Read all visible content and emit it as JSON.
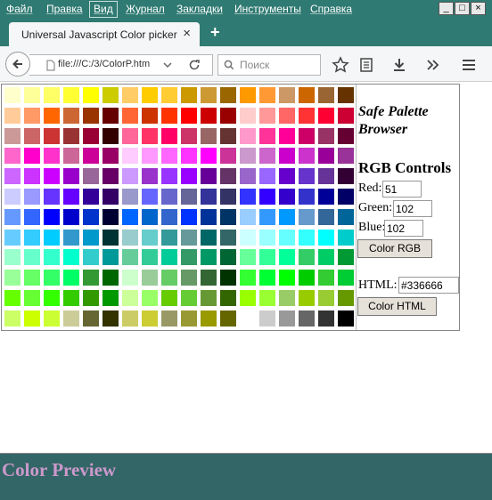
{
  "menu": {
    "items": [
      "Файл",
      "Правка",
      "Вид",
      "Журнал",
      "Закладки",
      "Инструменты",
      "Справка"
    ],
    "active_index": 2
  },
  "window_controls": [
    "_",
    "□",
    "×"
  ],
  "tab": {
    "title": "Universal Javascript Color picker",
    "close": "×",
    "new_tab": "+"
  },
  "navbar": {
    "url": "file:///C:/3/ColorP.htm",
    "search_placeholder": "Поиск",
    "icons": [
      "back-icon",
      "page-icon",
      "dropdown-icon",
      "reload-icon",
      "search-icon",
      "bookmark-star-icon",
      "reading-list-icon",
      "download-icon",
      "overflow-icon",
      "hamburger-menu-icon"
    ]
  },
  "palette": {
    "rows": [
      [
        "#ffffcc",
        "#ffff99",
        "#ffff66",
        "#ffff33",
        "#ffff00",
        "#cccc00",
        "#ffcc66",
        "#ffcc00",
        "#ffcc33",
        "#cc9900",
        "#cc9933",
        "#996600",
        "#ff9900",
        "#ff9933",
        "#cc9966",
        "#cc6600",
        "#996633",
        "#663300"
      ],
      [
        "#ffcc99",
        "#ff9966",
        "#ff6600",
        "#cc6633",
        "#993300",
        "#660000",
        "#ff6633",
        "#cc3300",
        "#ff3300",
        "#ff0000",
        "#cc0000",
        "#990000",
        "#ffcccc",
        "#ff9999",
        "#ff6666",
        "#ff3333",
        "#ff0033",
        "#cc0033"
      ],
      [
        "#cc9999",
        "#cc6666",
        "#cc3333",
        "#993333",
        "#990033",
        "#330000",
        "#ff6699",
        "#ff3366",
        "#ff0066",
        "#cc3366",
        "#996666",
        "#663333",
        "#ff99cc",
        "#ff3399",
        "#ff0099",
        "#cc0066",
        "#993366",
        "#660033"
      ],
      [
        "#ff66cc",
        "#ff00cc",
        "#ff33cc",
        "#cc6699",
        "#cc0099",
        "#990066",
        "#ffccff",
        "#ff99ff",
        "#ff66ff",
        "#ff33ff",
        "#ff00ff",
        "#cc3399",
        "#cc99cc",
        "#cc66cc",
        "#cc00cc",
        "#cc33cc",
        "#990099",
        "#993399"
      ],
      [
        "#cc66ff",
        "#cc33ff",
        "#cc00ff",
        "#9900cc",
        "#996699",
        "#660066",
        "#cc99ff",
        "#9933cc",
        "#9933ff",
        "#9900ff",
        "#660099",
        "#663366",
        "#9966cc",
        "#9966ff",
        "#6600cc",
        "#6633cc",
        "#663399",
        "#330033"
      ],
      [
        "#ccccff",
        "#9999ff",
        "#6633ff",
        "#6600ff",
        "#330099",
        "#330066",
        "#9999cc",
        "#6666ff",
        "#6666cc",
        "#666699",
        "#333399",
        "#333366",
        "#3333ff",
        "#3300ff",
        "#3300cc",
        "#3333cc",
        "#000099",
        "#000066"
      ],
      [
        "#6699ff",
        "#3366ff",
        "#0000ff",
        "#0000cc",
        "#0033cc",
        "#000033",
        "#0066ff",
        "#0066cc",
        "#3366cc",
        "#0033ff",
        "#003399",
        "#003366",
        "#99ccff",
        "#3399ff",
        "#0099ff",
        "#6699cc",
        "#336699",
        "#006699"
      ],
      [
        "#66ccff",
        "#33ccff",
        "#00ccff",
        "#3399cc",
        "#0099cc",
        "#003333",
        "#99cccc",
        "#66cccc",
        "#339999",
        "#669999",
        "#006666",
        "#336666",
        "#ccffff",
        "#99ffff",
        "#66ffff",
        "#33ffff",
        "#00ffff",
        "#00cccc"
      ],
      [
        "#99ffcc",
        "#66ffcc",
        "#33ffcc",
        "#00ffcc",
        "#33cccc",
        "#009999",
        "#66cc99",
        "#33cc99",
        "#00cc99",
        "#339966",
        "#009966",
        "#006633",
        "#66ff99",
        "#33ff99",
        "#00ff99",
        "#33cc66",
        "#00cc66",
        "#009933"
      ],
      [
        "#99ff99",
        "#66ff66",
        "#33ff66",
        "#00ff66",
        "#339933",
        "#006600",
        "#ccffcc",
        "#99cc99",
        "#66cc66",
        "#669966",
        "#336633",
        "#003300",
        "#33ff33",
        "#00ff33",
        "#00ff00",
        "#00cc00",
        "#33cc33",
        "#00cc33"
      ],
      [
        "#66ff00",
        "#66ff33",
        "#33ff00",
        "#33cc00",
        "#339900",
        "#009900",
        "#ccff99",
        "#99ff66",
        "#66cc00",
        "#66cc33",
        "#669933",
        "#336600",
        "#99ff00",
        "#99ff33",
        "#99cc66",
        "#99cc00",
        "#99cc33",
        "#669900"
      ],
      [
        "#ccff66",
        "#ccff00",
        "#ccff33",
        "#cccc99",
        "#666633",
        "#333300",
        "#cccc66",
        "#cccc33",
        "#999966",
        "#999933",
        "#999900",
        "#666600",
        "#ffffff",
        "#cccccc",
        "#999999",
        "#666666",
        "#333333",
        "#000000"
      ]
    ]
  },
  "controls": {
    "safe_title": "Safe Palette Browser",
    "rgb_title": "RGB Controls",
    "red_label": "Red:",
    "red_value": "51",
    "green_label": "Green:",
    "green_value": "102",
    "blue_label": "Blue:",
    "blue_value": "102",
    "color_rgb_button": "Color RGB",
    "html_label": "HTML:",
    "html_value": "#336666",
    "color_html_button": "Color HTML"
  },
  "preview": {
    "title": "Color Preview",
    "background": "#336666",
    "text_color": "#cc99cc"
  },
  "colors": {
    "titlebar": "#2f7a72",
    "toolbar": "#f5f6f7"
  }
}
